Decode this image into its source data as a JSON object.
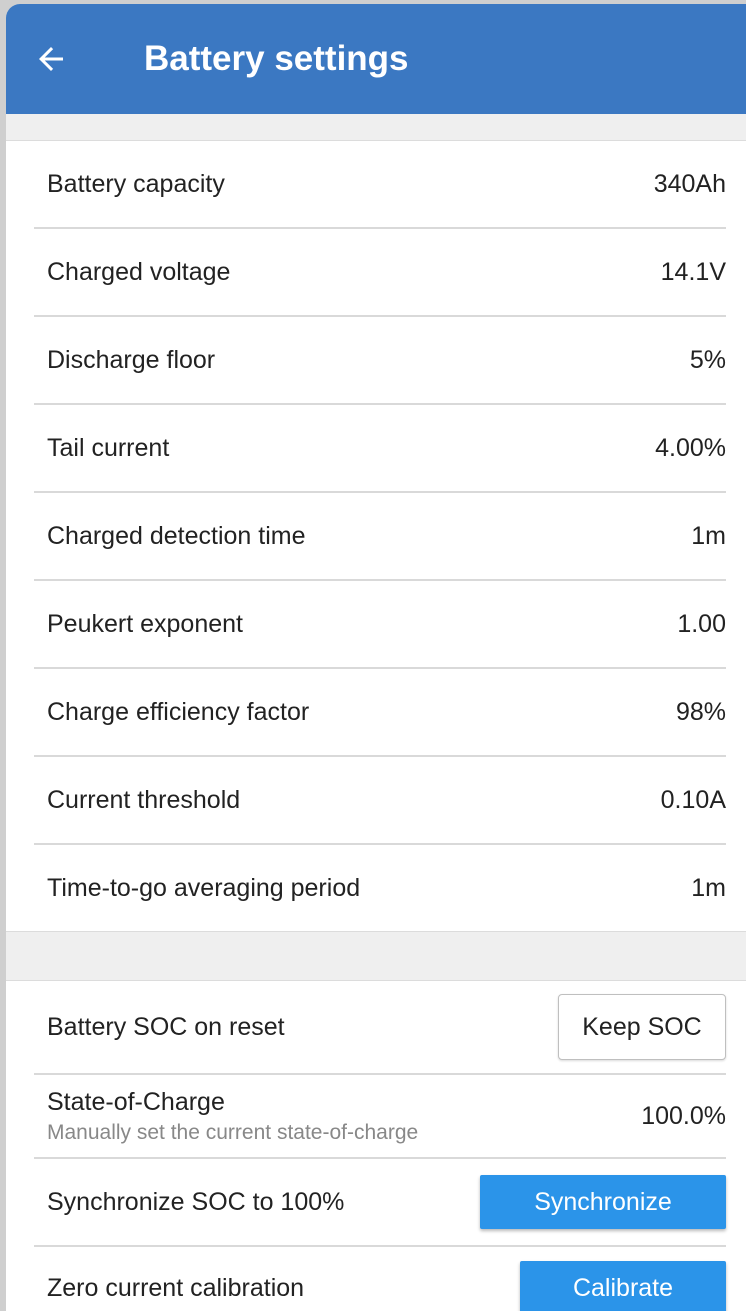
{
  "header": {
    "title": "Battery settings"
  },
  "settings": [
    {
      "label": "Battery capacity",
      "value": "340Ah"
    },
    {
      "label": "Charged voltage",
      "value": "14.1V"
    },
    {
      "label": "Discharge floor",
      "value": "5%"
    },
    {
      "label": "Tail current",
      "value": "4.00%"
    },
    {
      "label": "Charged detection time",
      "value": "1m"
    },
    {
      "label": "Peukert exponent",
      "value": "1.00"
    },
    {
      "label": "Charge efficiency factor",
      "value": "98%"
    },
    {
      "label": "Current threshold",
      "value": "0.10A"
    },
    {
      "label": "Time-to-go averaging period",
      "value": "1m"
    }
  ],
  "soc": {
    "reset_label": "Battery SOC on reset",
    "reset_button": "Keep SOC",
    "state_label": "State-of-Charge",
    "state_sublabel": "Manually set the current state-of-charge",
    "state_value": "100.0%",
    "sync_label": "Synchronize SOC to 100%",
    "sync_button": "Synchronize",
    "zero_label": "Zero current calibration",
    "zero_button": "Calibrate"
  },
  "colors": {
    "appbar": "#3b78c2",
    "button": "#2b94e9"
  }
}
